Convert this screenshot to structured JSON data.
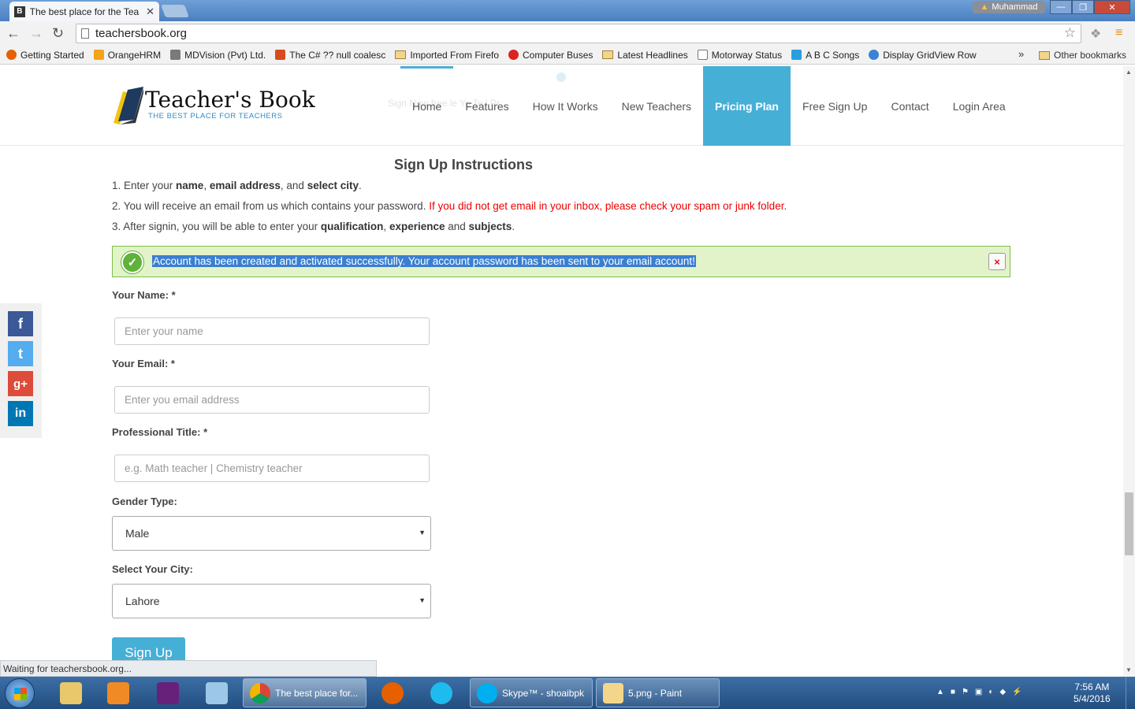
{
  "browser": {
    "tab_title": "The best place for the Tea",
    "tab_favicon": "B",
    "user_name": "Muhammad",
    "url": "teachersbook.org",
    "bookmarks": [
      {
        "label": "Getting Started",
        "icon": "firefox-icon",
        "color": "#e66000"
      },
      {
        "label": "OrangeHRM",
        "icon": "orangehrm-icon",
        "color": "#f4a31b"
      },
      {
        "label": "MDVision (Pvt) Ltd.",
        "icon": "mdvision-icon",
        "color": "#7a7a7a"
      },
      {
        "label": "The C# ?? null coalesc",
        "icon": "stackexchange-icon",
        "color": "#d84b1f"
      },
      {
        "label": "Imported From Firefo",
        "icon": "folder-icon",
        "color": "#f0d58a"
      },
      {
        "label": "Computer Buses",
        "icon": "help-icon",
        "color": "#d22"
      },
      {
        "label": "Latest Headlines",
        "icon": "folder-icon",
        "color": "#f0d58a"
      },
      {
        "label": "Motorway Status",
        "icon": "page-icon",
        "color": "#fff"
      },
      {
        "label": "A B C Songs",
        "icon": "pandora-icon",
        "color": "#2a9fe0"
      },
      {
        "label": "Display GridView Row",
        "icon": "aspnet-icon",
        "color": "#3b82d4"
      }
    ],
    "bookmarks_overflow": "»",
    "other_bookmarks": "Other bookmarks",
    "status_text": "Waiting for teachersbook.org..."
  },
  "site": {
    "logo_main": "Teacher's Book",
    "logo_sub": "THE BEST PLACE FOR TEACHERS",
    "ghost_text": "Sign      Now free        le Yo     Te             l   Pr",
    "menu": [
      "Home",
      "Features",
      "How It Works",
      "New Teachers",
      "Pricing Plan",
      "Free Sign Up",
      "Contact",
      "Login Area"
    ]
  },
  "instructions": {
    "title": "Sign Up Instructions",
    "line1": {
      "prefix": "1. Enter your ",
      "b1": "name",
      "sep1": ", ",
      "b2": "email address",
      "sep2": ", and ",
      "b3": "select city",
      "suffix": "."
    },
    "line2": {
      "text": "2. You will receive an email from us which contains your password. ",
      "warning": "If you did not get email in your inbox, please check your spam or junk folder."
    },
    "line3": {
      "prefix": "3. After signin, you will be able to enter your ",
      "b1": "qualification",
      "sep1": ", ",
      "b2": "experience",
      "sep2": " and ",
      "b3": "subjects",
      "suffix": "."
    }
  },
  "alert": {
    "message": "Account has been created and activated successfully. Your account password has been sent to your email account!",
    "close": "×"
  },
  "form": {
    "name_label": "Your Name: *",
    "name_placeholder": "Enter your name",
    "email_label": "Your Email: *",
    "email_placeholder": "Enter you email address",
    "title_label": "Professional Title: *",
    "title_placeholder": "e.g. Math teacher | Chemistry teacher",
    "gender_label": "Gender Type:",
    "gender_value": "Male",
    "city_label": "Select Your City:",
    "city_value": "Lahore",
    "submit": "Sign Up"
  },
  "social": {
    "facebook": "f",
    "twitter": "t",
    "googleplus": "g+",
    "linkedin": "in"
  },
  "taskbar": {
    "tasks": [
      "The best place for...",
      "Skype™ - shoaibpk",
      "5.png - Paint"
    ],
    "time": "7:56 AM",
    "date": "5/4/2016"
  },
  "colors": {
    "accent": "#46afd6",
    "alert_bg": "#e2f3c9",
    "warning": "#ee0000"
  }
}
